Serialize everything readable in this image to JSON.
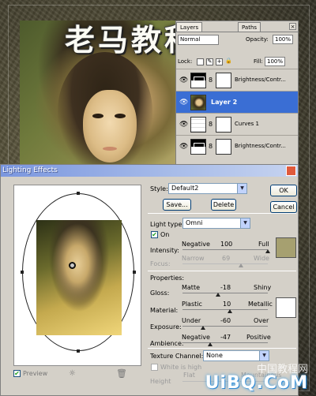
{
  "overlay_title": "老马教程",
  "layers_panel": {
    "tabs": [
      "Layers",
      "Paths"
    ],
    "blend_mode": "Normal",
    "opacity_label": "Opacity:",
    "opacity_value": "100%",
    "lock_label": "Lock:",
    "fill_label": "Fill:",
    "fill_value": "100%",
    "layers": [
      {
        "name": "Brightness/Contr...",
        "kind": "adjustment"
      },
      {
        "name": "Layer 2",
        "kind": "pixel",
        "selected": true
      },
      {
        "name": "Curves 1",
        "kind": "curves"
      },
      {
        "name": "Brightness/Contr...",
        "kind": "adjustment"
      }
    ]
  },
  "dialog": {
    "title": "Lighting Effects",
    "style_label": "Style:",
    "style_value": "Default2",
    "save_label": "Save...",
    "delete_label": "Delete",
    "ok_label": "OK",
    "cancel_label": "Cancel",
    "light_type_label": "Light type:",
    "light_type_value": "Omni",
    "on_label": "On",
    "intensity": {
      "label": "Intensity:",
      "min": "Negative",
      "value": "100",
      "max": "Full"
    },
    "focus": {
      "label": "Focus:",
      "min": "Narrow",
      "value": "69",
      "max": "Wide"
    },
    "properties_label": "Properties:",
    "gloss": {
      "label": "Gloss:",
      "min": "Matte",
      "value": "-18",
      "max": "Shiny"
    },
    "material": {
      "label": "Material:",
      "min": "Plastic",
      "value": "10",
      "max": "Metallic"
    },
    "exposure": {
      "label": "Exposure:",
      "min": "Under",
      "value": "-60",
      "max": "Over"
    },
    "ambience": {
      "label": "Ambience:",
      "min": "Negative",
      "value": "-47",
      "max": "Positive"
    },
    "texture_label": "Texture Channel:",
    "texture_value": "None",
    "white_is_high_label": "White is high",
    "height_label": "Height",
    "flat_label": "Flat",
    "mountainous_label": "Mountainous",
    "preview_label": "Preview",
    "light_color": "#a6a070",
    "ambient_color": "#ffffff"
  },
  "watermark": {
    "cn": "中国教程网",
    "en": "UiBQ.CoM"
  }
}
